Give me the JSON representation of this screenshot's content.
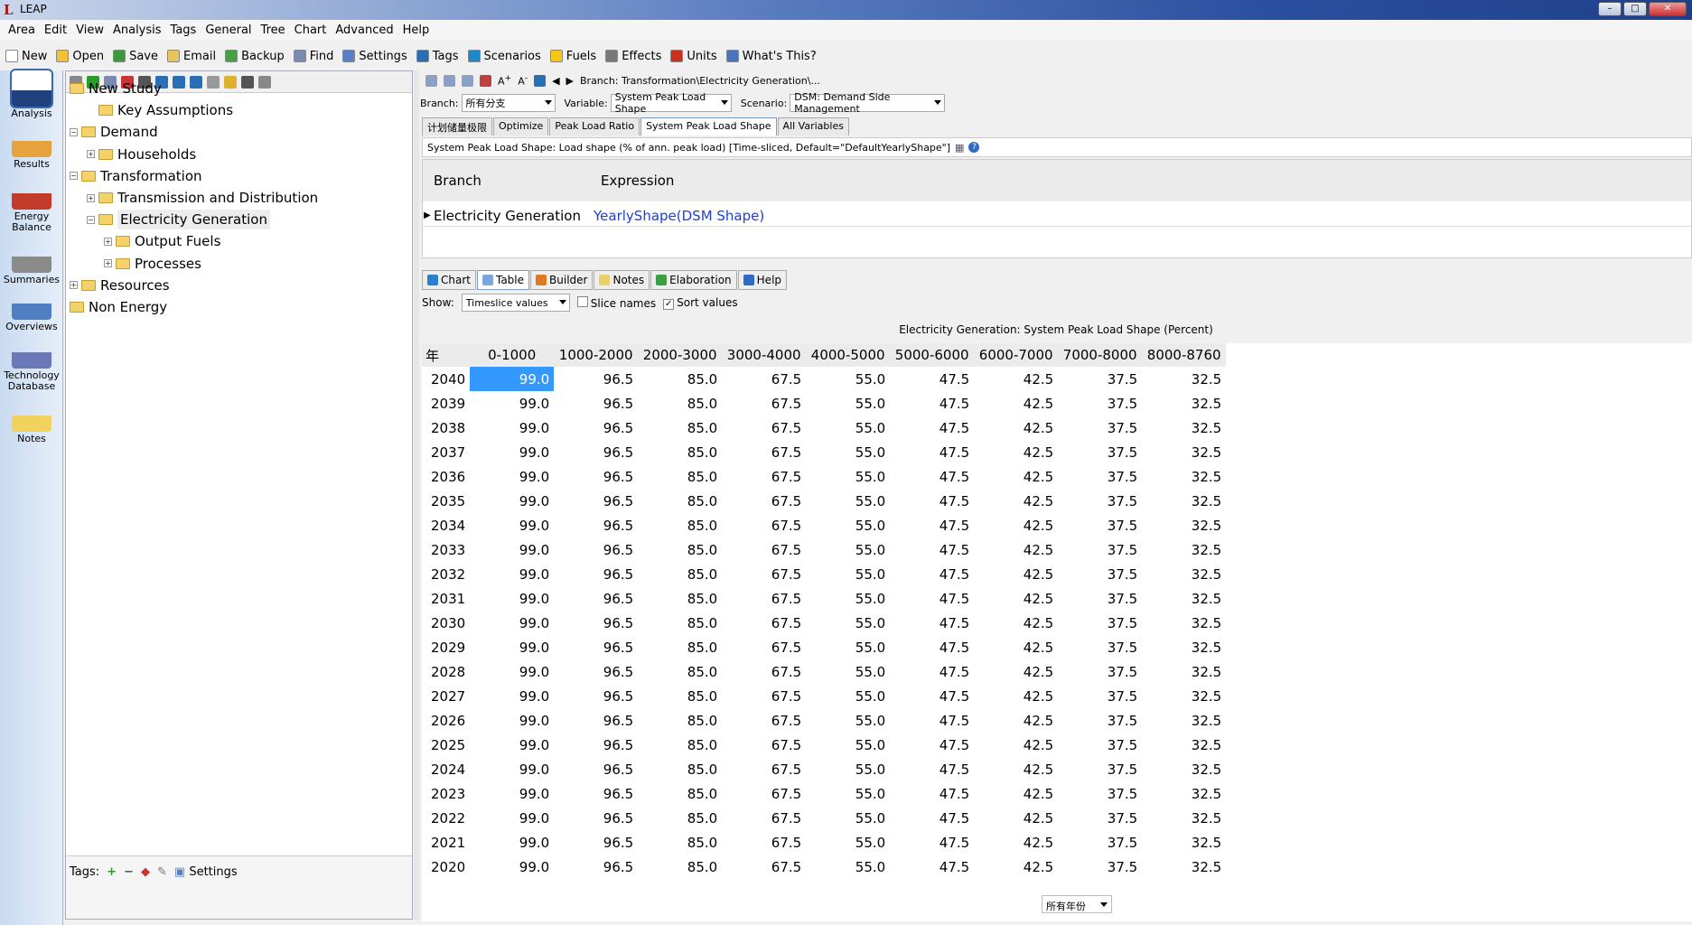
{
  "window": {
    "title": "LEAP"
  },
  "menu": [
    "Area",
    "Edit",
    "View",
    "Analysis",
    "Tags",
    "General",
    "Tree",
    "Chart",
    "Advanced",
    "Help"
  ],
  "toolbar": [
    {
      "label": "New",
      "icon": "new-icon",
      "color": "#ffffff"
    },
    {
      "label": "Open",
      "icon": "open-icon",
      "color": "#f2c23a"
    },
    {
      "label": "Save",
      "icon": "save-icon",
      "color": "#3a9a3a"
    },
    {
      "label": "Email",
      "icon": "email-icon",
      "color": "#e8c45c"
    },
    {
      "label": "Backup",
      "icon": "backup-icon",
      "color": "#46a046"
    },
    {
      "label": "Find",
      "icon": "find-icon",
      "color": "#7a8ab0"
    },
    {
      "label": "Settings",
      "icon": "settings-icon",
      "color": "#5b7fc4"
    },
    {
      "label": "Tags",
      "icon": "tags-icon",
      "color": "#2a6fb5"
    },
    {
      "label": "Scenarios",
      "icon": "scenarios-icon",
      "color": "#1e88c9"
    },
    {
      "label": "Fuels",
      "icon": "fuels-icon",
      "color": "#f5c518"
    },
    {
      "label": "Effects",
      "icon": "effects-icon",
      "color": "#777777"
    },
    {
      "label": "Units",
      "icon": "units-icon",
      "color": "#c83020"
    },
    {
      "label": "What's This?",
      "icon": "whats-this-icon",
      "color": "#4a74c0"
    }
  ],
  "views": [
    {
      "label": "Analysis",
      "icon": "analysis-icon",
      "active": true
    },
    {
      "label": "Results",
      "icon": "results-icon"
    },
    {
      "label": "Energy Balance",
      "icon": "energy-balance-icon"
    },
    {
      "label": "Summaries",
      "icon": "summaries-icon"
    },
    {
      "label": "Overviews",
      "icon": "overviews-icon"
    },
    {
      "label": "Technology Database",
      "icon": "technology-database-icon"
    },
    {
      "label": "Notes",
      "icon": "notes-icon"
    }
  ],
  "tree": [
    {
      "label": "New Study",
      "level": 0,
      "expander": ""
    },
    {
      "label": "Key Assumptions",
      "level": 1,
      "expander": ""
    },
    {
      "label": "Demand",
      "level": 0,
      "expander": "−"
    },
    {
      "label": "Households",
      "level": 1,
      "expander": "+"
    },
    {
      "label": "Transformation",
      "level": 0,
      "expander": "−"
    },
    {
      "label": "Transmission and Distribution",
      "level": 1,
      "expander": "+"
    },
    {
      "label": "Electricity Generation",
      "level": 1,
      "expander": "−",
      "selected": true
    },
    {
      "label": "Output Fuels",
      "level": 2,
      "expander": "+"
    },
    {
      "label": "Processes",
      "level": 2,
      "expander": "+"
    },
    {
      "label": "Resources",
      "level": 0,
      "expander": "+"
    },
    {
      "label": "Non Energy",
      "level": 0,
      "expander": ""
    }
  ],
  "tags_bar": {
    "label": "Tags:",
    "settings": "Settings"
  },
  "branch_path": "Branch: Transformation\\Electricity Generation\\...",
  "selectors": {
    "branch_label": "Branch:",
    "branch_value": "所有分支",
    "variable_label": "Variable:",
    "variable_value": "System Peak Load Shape",
    "scenario_label": "Scenario:",
    "scenario_value": "DSM: Demand Side Management"
  },
  "variable_tabs": [
    {
      "label": "计划储量极限"
    },
    {
      "label": "Optimize"
    },
    {
      "label": "Peak Load Ratio"
    },
    {
      "label": "System Peak Load Shape",
      "active": true
    },
    {
      "label": "All Variables"
    }
  ],
  "variable_description": "System Peak Load Shape: Load shape (% of ann. peak load) [Time-sliced, Default=\"DefaultYearlyShape\"]",
  "expression_grid": {
    "branch_header": "Branch",
    "expression_header": "Expression",
    "row_branch": "Electricity Generation",
    "row_expression": "YearlyShape(DSM Shape)"
  },
  "sub_tabs": [
    {
      "label": "Chart",
      "icon": "chart-icon",
      "color": "#2a7fd0"
    },
    {
      "label": "Table",
      "icon": "table-icon",
      "color": "#7aa6e0",
      "active": true
    },
    {
      "label": "Builder",
      "icon": "builder-icon",
      "color": "#e07a20"
    },
    {
      "label": "Notes",
      "icon": "notes-icon",
      "color": "#e8d06a"
    },
    {
      "label": "Elaboration",
      "icon": "elaboration-icon",
      "color": "#3aa040"
    },
    {
      "label": "Help",
      "icon": "help-icon",
      "color": "#2d6bc7"
    }
  ],
  "show_bar": {
    "show_label": "Show:",
    "show_value": "Timeslice values",
    "slice_names_label": "Slice names",
    "slice_names_checked": false,
    "sort_values_label": "Sort values",
    "sort_values_checked": true
  },
  "table": {
    "title": "Electricity Generation: System Peak Load Shape (Percent)",
    "year_header": "年",
    "columns": [
      "0-1000",
      "1000-2000",
      "2000-3000",
      "3000-4000",
      "4000-5000",
      "5000-6000",
      "6000-7000",
      "7000-8000",
      "8000-8760"
    ],
    "rows": [
      {
        "year": "2040",
        "values": [
          "99.0",
          "96.5",
          "85.0",
          "67.5",
          "55.0",
          "47.5",
          "42.5",
          "37.5",
          "32.5"
        ]
      },
      {
        "year": "2039",
        "values": [
          "99.0",
          "96.5",
          "85.0",
          "67.5",
          "55.0",
          "47.5",
          "42.5",
          "37.5",
          "32.5"
        ]
      },
      {
        "year": "2038",
        "values": [
          "99.0",
          "96.5",
          "85.0",
          "67.5",
          "55.0",
          "47.5",
          "42.5",
          "37.5",
          "32.5"
        ]
      },
      {
        "year": "2037",
        "values": [
          "99.0",
          "96.5",
          "85.0",
          "67.5",
          "55.0",
          "47.5",
          "42.5",
          "37.5",
          "32.5"
        ]
      },
      {
        "year": "2036",
        "values": [
          "99.0",
          "96.5",
          "85.0",
          "67.5",
          "55.0",
          "47.5",
          "42.5",
          "37.5",
          "32.5"
        ]
      },
      {
        "year": "2035",
        "values": [
          "99.0",
          "96.5",
          "85.0",
          "67.5",
          "55.0",
          "47.5",
          "42.5",
          "37.5",
          "32.5"
        ]
      },
      {
        "year": "2034",
        "values": [
          "99.0",
          "96.5",
          "85.0",
          "67.5",
          "55.0",
          "47.5",
          "42.5",
          "37.5",
          "32.5"
        ]
      },
      {
        "year": "2033",
        "values": [
          "99.0",
          "96.5",
          "85.0",
          "67.5",
          "55.0",
          "47.5",
          "42.5",
          "37.5",
          "32.5"
        ]
      },
      {
        "year": "2032",
        "values": [
          "99.0",
          "96.5",
          "85.0",
          "67.5",
          "55.0",
          "47.5",
          "42.5",
          "37.5",
          "32.5"
        ]
      },
      {
        "year": "2031",
        "values": [
          "99.0",
          "96.5",
          "85.0",
          "67.5",
          "55.0",
          "47.5",
          "42.5",
          "37.5",
          "32.5"
        ]
      },
      {
        "year": "2030",
        "values": [
          "99.0",
          "96.5",
          "85.0",
          "67.5",
          "55.0",
          "47.5",
          "42.5",
          "37.5",
          "32.5"
        ]
      },
      {
        "year": "2029",
        "values": [
          "99.0",
          "96.5",
          "85.0",
          "67.5",
          "55.0",
          "47.5",
          "42.5",
          "37.5",
          "32.5"
        ]
      },
      {
        "year": "2028",
        "values": [
          "99.0",
          "96.5",
          "85.0",
          "67.5",
          "55.0",
          "47.5",
          "42.5",
          "37.5",
          "32.5"
        ]
      },
      {
        "year": "2027",
        "values": [
          "99.0",
          "96.5",
          "85.0",
          "67.5",
          "55.0",
          "47.5",
          "42.5",
          "37.5",
          "32.5"
        ]
      },
      {
        "year": "2026",
        "values": [
          "99.0",
          "96.5",
          "85.0",
          "67.5",
          "55.0",
          "47.5",
          "42.5",
          "37.5",
          "32.5"
        ]
      },
      {
        "year": "2025",
        "values": [
          "99.0",
          "96.5",
          "85.0",
          "67.5",
          "55.0",
          "47.5",
          "42.5",
          "37.5",
          "32.5"
        ]
      },
      {
        "year": "2024",
        "values": [
          "99.0",
          "96.5",
          "85.0",
          "67.5",
          "55.0",
          "47.5",
          "42.5",
          "37.5",
          "32.5"
        ]
      },
      {
        "year": "2023",
        "values": [
          "99.0",
          "96.5",
          "85.0",
          "67.5",
          "55.0",
          "47.5",
          "42.5",
          "37.5",
          "32.5"
        ]
      },
      {
        "year": "2022",
        "values": [
          "99.0",
          "96.5",
          "85.0",
          "67.5",
          "55.0",
          "47.5",
          "42.5",
          "37.5",
          "32.5"
        ]
      },
      {
        "year": "2021",
        "values": [
          "99.0",
          "96.5",
          "85.0",
          "67.5",
          "55.0",
          "47.5",
          "42.5",
          "37.5",
          "32.5"
        ]
      },
      {
        "year": "2020",
        "values": [
          "99.0",
          "96.5",
          "85.0",
          "67.5",
          "55.0",
          "47.5",
          "42.5",
          "37.5",
          "32.5"
        ]
      }
    ]
  },
  "year_filter": "所有年份"
}
